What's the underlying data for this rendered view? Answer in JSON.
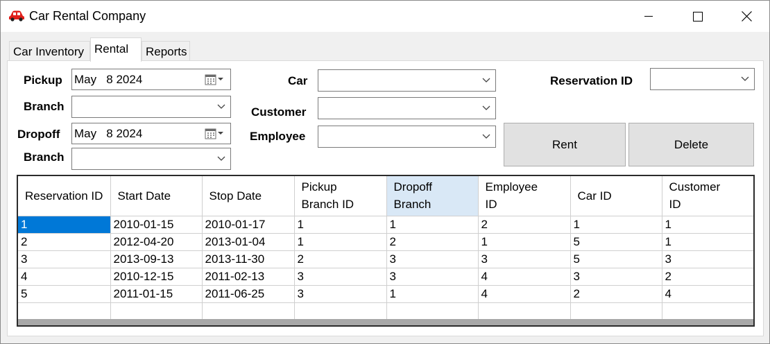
{
  "window": {
    "title": "Car Rental Company"
  },
  "tabs": [
    {
      "label": "Car Inventory"
    },
    {
      "label": "Rental"
    },
    {
      "label": "Reports"
    }
  ],
  "form": {
    "pickup_label": "Pickup",
    "pickup_date": "May   8 2024",
    "pickup_branch_label": "Branch",
    "pickup_branch_value": "",
    "dropoff_label": "Dropoff",
    "dropoff_date": "May   8 2024",
    "dropoff_branch_label": "Branch",
    "dropoff_branch_value": "",
    "car_label": "Car",
    "car_value": "",
    "customer_label": "Customer",
    "customer_value": "",
    "employee_label": "Employee",
    "employee_value": "",
    "reservation_label": "Reservation ID",
    "reservation_value": ""
  },
  "buttons": {
    "rent": "Rent",
    "delete": "Delete"
  },
  "table": {
    "columns": [
      [
        "Reservation ID"
      ],
      [
        "Start Date"
      ],
      [
        "Stop Date"
      ],
      [
        "Pickup",
        "Branch ID"
      ],
      [
        "Dropoff",
        "Branch"
      ],
      [
        "Employee",
        "ID"
      ],
      [
        "Car ID"
      ],
      [
        "Customer",
        "ID"
      ]
    ],
    "rows": [
      [
        "1",
        "2010-01-15",
        "2010-01-17",
        "1",
        "1",
        "2",
        "1",
        "1"
      ],
      [
        "2",
        "2012-04-20",
        "2013-01-04",
        "1",
        "2",
        "1",
        "5",
        "1"
      ],
      [
        "3",
        "2013-09-13",
        "2013-11-30",
        "2",
        "3",
        "3",
        "5",
        "3"
      ],
      [
        "4",
        "2010-12-15",
        "2011-02-13",
        "3",
        "3",
        "4",
        "3",
        "2"
      ],
      [
        "5",
        "2011-01-15",
        "2011-06-25",
        "3",
        "1",
        "4",
        "2",
        "4"
      ],
      [
        "",
        "",
        "",
        "",
        "",
        "",
        "",
        ""
      ]
    ],
    "selected_header": 4,
    "current_cell": [
      0,
      0
    ]
  },
  "colors": {
    "selection": "#0078d7",
    "header_highlight": "#d9e8f6",
    "app_icon": "#e0201b"
  }
}
